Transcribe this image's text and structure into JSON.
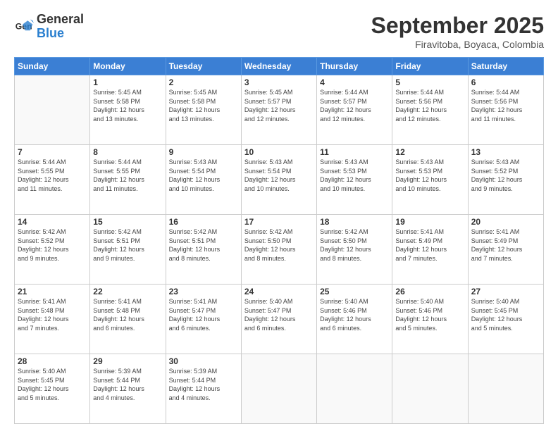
{
  "header": {
    "logo_general": "General",
    "logo_blue": "Blue",
    "month": "September 2025",
    "location": "Firavitoba, Boyaca, Colombia"
  },
  "columns": [
    "Sunday",
    "Monday",
    "Tuesday",
    "Wednesday",
    "Thursday",
    "Friday",
    "Saturday"
  ],
  "weeks": [
    [
      {
        "day": "",
        "info": ""
      },
      {
        "day": "1",
        "info": "Sunrise: 5:45 AM\nSunset: 5:58 PM\nDaylight: 12 hours\nand 13 minutes."
      },
      {
        "day": "2",
        "info": "Sunrise: 5:45 AM\nSunset: 5:58 PM\nDaylight: 12 hours\nand 13 minutes."
      },
      {
        "day": "3",
        "info": "Sunrise: 5:45 AM\nSunset: 5:57 PM\nDaylight: 12 hours\nand 12 minutes."
      },
      {
        "day": "4",
        "info": "Sunrise: 5:44 AM\nSunset: 5:57 PM\nDaylight: 12 hours\nand 12 minutes."
      },
      {
        "day": "5",
        "info": "Sunrise: 5:44 AM\nSunset: 5:56 PM\nDaylight: 12 hours\nand 12 minutes."
      },
      {
        "day": "6",
        "info": "Sunrise: 5:44 AM\nSunset: 5:56 PM\nDaylight: 12 hours\nand 11 minutes."
      }
    ],
    [
      {
        "day": "7",
        "info": "Sunrise: 5:44 AM\nSunset: 5:55 PM\nDaylight: 12 hours\nand 11 minutes."
      },
      {
        "day": "8",
        "info": "Sunrise: 5:44 AM\nSunset: 5:55 PM\nDaylight: 12 hours\nand 11 minutes."
      },
      {
        "day": "9",
        "info": "Sunrise: 5:43 AM\nSunset: 5:54 PM\nDaylight: 12 hours\nand 10 minutes."
      },
      {
        "day": "10",
        "info": "Sunrise: 5:43 AM\nSunset: 5:54 PM\nDaylight: 12 hours\nand 10 minutes."
      },
      {
        "day": "11",
        "info": "Sunrise: 5:43 AM\nSunset: 5:53 PM\nDaylight: 12 hours\nand 10 minutes."
      },
      {
        "day": "12",
        "info": "Sunrise: 5:43 AM\nSunset: 5:53 PM\nDaylight: 12 hours\nand 10 minutes."
      },
      {
        "day": "13",
        "info": "Sunrise: 5:43 AM\nSunset: 5:52 PM\nDaylight: 12 hours\nand 9 minutes."
      }
    ],
    [
      {
        "day": "14",
        "info": "Sunrise: 5:42 AM\nSunset: 5:52 PM\nDaylight: 12 hours\nand 9 minutes."
      },
      {
        "day": "15",
        "info": "Sunrise: 5:42 AM\nSunset: 5:51 PM\nDaylight: 12 hours\nand 9 minutes."
      },
      {
        "day": "16",
        "info": "Sunrise: 5:42 AM\nSunset: 5:51 PM\nDaylight: 12 hours\nand 8 minutes."
      },
      {
        "day": "17",
        "info": "Sunrise: 5:42 AM\nSunset: 5:50 PM\nDaylight: 12 hours\nand 8 minutes."
      },
      {
        "day": "18",
        "info": "Sunrise: 5:42 AM\nSunset: 5:50 PM\nDaylight: 12 hours\nand 8 minutes."
      },
      {
        "day": "19",
        "info": "Sunrise: 5:41 AM\nSunset: 5:49 PM\nDaylight: 12 hours\nand 7 minutes."
      },
      {
        "day": "20",
        "info": "Sunrise: 5:41 AM\nSunset: 5:49 PM\nDaylight: 12 hours\nand 7 minutes."
      }
    ],
    [
      {
        "day": "21",
        "info": "Sunrise: 5:41 AM\nSunset: 5:48 PM\nDaylight: 12 hours\nand 7 minutes."
      },
      {
        "day": "22",
        "info": "Sunrise: 5:41 AM\nSunset: 5:48 PM\nDaylight: 12 hours\nand 6 minutes."
      },
      {
        "day": "23",
        "info": "Sunrise: 5:41 AM\nSunset: 5:47 PM\nDaylight: 12 hours\nand 6 minutes."
      },
      {
        "day": "24",
        "info": "Sunrise: 5:40 AM\nSunset: 5:47 PM\nDaylight: 12 hours\nand 6 minutes."
      },
      {
        "day": "25",
        "info": "Sunrise: 5:40 AM\nSunset: 5:46 PM\nDaylight: 12 hours\nand 6 minutes."
      },
      {
        "day": "26",
        "info": "Sunrise: 5:40 AM\nSunset: 5:46 PM\nDaylight: 12 hours\nand 5 minutes."
      },
      {
        "day": "27",
        "info": "Sunrise: 5:40 AM\nSunset: 5:45 PM\nDaylight: 12 hours\nand 5 minutes."
      }
    ],
    [
      {
        "day": "28",
        "info": "Sunrise: 5:40 AM\nSunset: 5:45 PM\nDaylight: 12 hours\nand 5 minutes."
      },
      {
        "day": "29",
        "info": "Sunrise: 5:39 AM\nSunset: 5:44 PM\nDaylight: 12 hours\nand 4 minutes."
      },
      {
        "day": "30",
        "info": "Sunrise: 5:39 AM\nSunset: 5:44 PM\nDaylight: 12 hours\nand 4 minutes."
      },
      {
        "day": "",
        "info": ""
      },
      {
        "day": "",
        "info": ""
      },
      {
        "day": "",
        "info": ""
      },
      {
        "day": "",
        "info": ""
      }
    ]
  ]
}
